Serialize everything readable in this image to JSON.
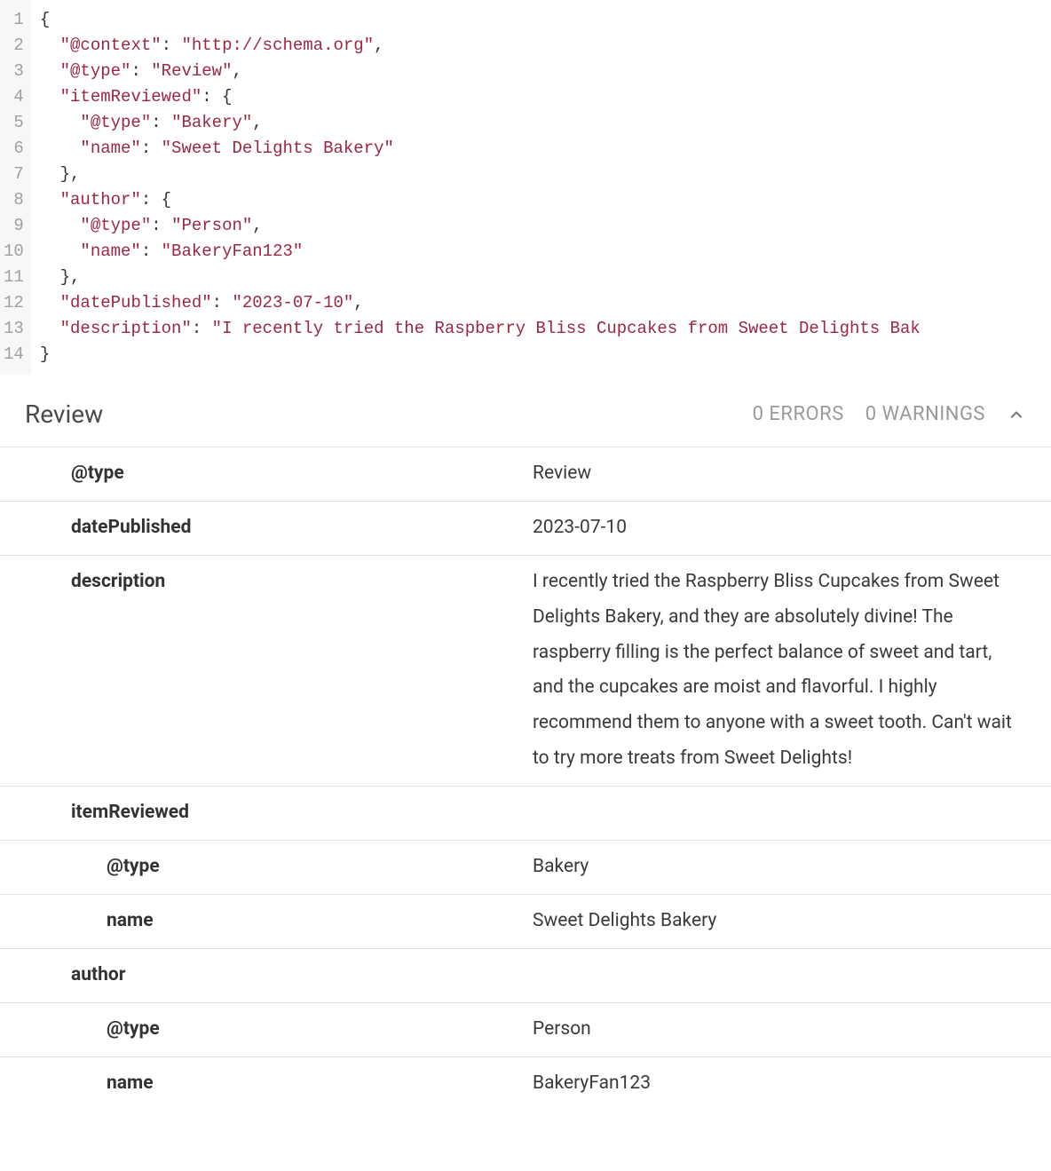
{
  "editor": {
    "lines": [
      {
        "n": 1,
        "indent": 0,
        "tokens": [
          {
            "t": "brace",
            "v": "{"
          }
        ]
      },
      {
        "n": 2,
        "indent": 1,
        "tokens": [
          {
            "t": "key",
            "v": "\"@context\""
          },
          {
            "t": "punct",
            "v": ": "
          },
          {
            "t": "str",
            "v": "\"http://schema.org\""
          },
          {
            "t": "punct",
            "v": ","
          }
        ]
      },
      {
        "n": 3,
        "indent": 1,
        "tokens": [
          {
            "t": "key",
            "v": "\"@type\""
          },
          {
            "t": "punct",
            "v": ": "
          },
          {
            "t": "str",
            "v": "\"Review\""
          },
          {
            "t": "punct",
            "v": ","
          }
        ]
      },
      {
        "n": 4,
        "indent": 1,
        "tokens": [
          {
            "t": "key",
            "v": "\"itemReviewed\""
          },
          {
            "t": "punct",
            "v": ": "
          },
          {
            "t": "brace",
            "v": "{"
          }
        ]
      },
      {
        "n": 5,
        "indent": 2,
        "tokens": [
          {
            "t": "key",
            "v": "\"@type\""
          },
          {
            "t": "punct",
            "v": ": "
          },
          {
            "t": "str",
            "v": "\"Bakery\""
          },
          {
            "t": "punct",
            "v": ","
          }
        ]
      },
      {
        "n": 6,
        "indent": 2,
        "tokens": [
          {
            "t": "key",
            "v": "\"name\""
          },
          {
            "t": "punct",
            "v": ": "
          },
          {
            "t": "str",
            "v": "\"Sweet Delights Bakery\""
          }
        ]
      },
      {
        "n": 7,
        "indent": 1,
        "tokens": [
          {
            "t": "brace",
            "v": "}"
          },
          {
            "t": "punct",
            "v": ","
          }
        ]
      },
      {
        "n": 8,
        "indent": 1,
        "tokens": [
          {
            "t": "key",
            "v": "\"author\""
          },
          {
            "t": "punct",
            "v": ": "
          },
          {
            "t": "brace",
            "v": "{"
          }
        ]
      },
      {
        "n": 9,
        "indent": 2,
        "tokens": [
          {
            "t": "key",
            "v": "\"@type\""
          },
          {
            "t": "punct",
            "v": ": "
          },
          {
            "t": "str",
            "v": "\"Person\""
          },
          {
            "t": "punct",
            "v": ","
          }
        ]
      },
      {
        "n": 10,
        "indent": 2,
        "tokens": [
          {
            "t": "key",
            "v": "\"name\""
          },
          {
            "t": "punct",
            "v": ": "
          },
          {
            "t": "str",
            "v": "\"BakeryFan123\""
          }
        ]
      },
      {
        "n": 11,
        "indent": 1,
        "tokens": [
          {
            "t": "brace",
            "v": "}"
          },
          {
            "t": "punct",
            "v": ","
          }
        ]
      },
      {
        "n": 12,
        "indent": 1,
        "tokens": [
          {
            "t": "key",
            "v": "\"datePublished\""
          },
          {
            "t": "punct",
            "v": ": "
          },
          {
            "t": "str",
            "v": "\"2023-07-10\""
          },
          {
            "t": "punct",
            "v": ","
          }
        ]
      },
      {
        "n": 13,
        "indent": 1,
        "tokens": [
          {
            "t": "key",
            "v": "\"description\""
          },
          {
            "t": "punct",
            "v": ": "
          },
          {
            "t": "str",
            "v": "\"I recently tried the Raspberry Bliss Cupcakes from Sweet Delights Bak"
          }
        ]
      },
      {
        "n": 14,
        "indent": 0,
        "tokens": [
          {
            "t": "brace",
            "v": "}"
          }
        ]
      }
    ]
  },
  "results": {
    "title": "Review",
    "errors_label": "0 ERRORS",
    "warnings_label": "0 WARNINGS",
    "rows": [
      {
        "indent": 1,
        "key": "@type",
        "value": "Review"
      },
      {
        "indent": 1,
        "key": "datePublished",
        "value": "2023-07-10"
      },
      {
        "indent": 1,
        "key": "description",
        "value": "I recently tried the Raspberry Bliss Cupcakes from Sweet Delights Bakery, and they are absolutely divine! The raspberry filling is the perfect balance of sweet and tart, and the cupcakes are moist and flavorful. I highly recommend them to anyone with a sweet tooth. Can't wait to try more treats from Sweet Delights!"
      },
      {
        "indent": 1,
        "key": "itemReviewed",
        "value": ""
      },
      {
        "indent": 2,
        "key": "@type",
        "value": "Bakery"
      },
      {
        "indent": 2,
        "key": "name",
        "value": "Sweet Delights Bakery"
      },
      {
        "indent": 1,
        "key": "author",
        "value": ""
      },
      {
        "indent": 2,
        "key": "@type",
        "value": "Person"
      },
      {
        "indent": 2,
        "key": "name",
        "value": "BakeryFan123"
      }
    ]
  }
}
